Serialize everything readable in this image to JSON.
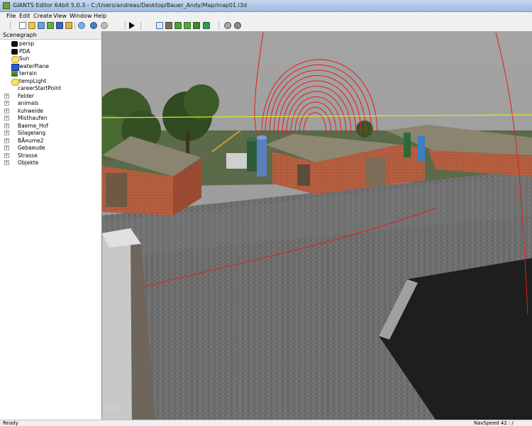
{
  "window": {
    "title": "GIANTS Editor 64bit 5.0.3 - C:/Users/andreas/Desktop/Bauer_Andy/Map/map01.i3d"
  },
  "menu": {
    "file": "File",
    "edit": "Edit",
    "create": "Create",
    "view": "View",
    "window": "Window",
    "help": "Help"
  },
  "toolbar": {
    "icons": [
      "new-icon",
      "open-icon",
      "import-icon",
      "export-icon",
      "save-icon",
      "save-as-icon",
      "reload-icon",
      "undo-icon",
      "redo-icon",
      "play-icon",
      "select-icon",
      "terrain-sculpt-icon",
      "terrain-paint-icon",
      "foliage-icon",
      "grass-icon",
      "gear-icon",
      "settings-icon"
    ]
  },
  "scenegraph": {
    "title": "Scenegraph",
    "nodes": [
      {
        "label": "persp",
        "icon": "camera-icon",
        "expandable": false
      },
      {
        "label": "PDA",
        "icon": "camera-icon",
        "expandable": false
      },
      {
        "label": "Sun",
        "icon": "light-icon",
        "expandable": false
      },
      {
        "label": "waterPlane",
        "icon": "shape-icon",
        "expandable": false
      },
      {
        "label": "terrain",
        "icon": "terrain-icon",
        "expandable": false
      },
      {
        "label": "tempLight",
        "icon": "light-icon",
        "expandable": false
      },
      {
        "label": "careerStartPoint",
        "icon": "transform-icon",
        "expandable": false
      },
      {
        "label": "Felder",
        "icon": "transform-icon",
        "expandable": true
      },
      {
        "label": "animals",
        "icon": "transform-icon",
        "expandable": true
      },
      {
        "label": "kuhweide",
        "icon": "transform-icon",
        "expandable": true
      },
      {
        "label": "Misthaufen",
        "icon": "transform-icon",
        "expandable": true
      },
      {
        "label": "Baeme_Hof",
        "icon": "transform-icon",
        "expandable": true
      },
      {
        "label": "Silagelang",
        "icon": "transform-icon",
        "expandable": true
      },
      {
        "label": "BÃ¤ume2",
        "icon": "transform-icon",
        "expandable": true
      },
      {
        "label": "Gebaeude",
        "icon": "transform-icon",
        "expandable": true
      },
      {
        "label": "Strasse",
        "icon": "transform-icon",
        "expandable": true
      },
      {
        "label": "Objekte",
        "icon": "transform-icon",
        "expandable": true
      }
    ]
  },
  "viewport": {
    "camera_label": "persp"
  },
  "statusbar": {
    "left": "Ready",
    "right": "NavSpeed 42 : /"
  },
  "colors": {
    "accent_red": "#e81b1b",
    "sky": "#9c9c9c",
    "pavement": "#6f6f6f",
    "brick": "#b0583c",
    "roof": "#8a8470"
  }
}
